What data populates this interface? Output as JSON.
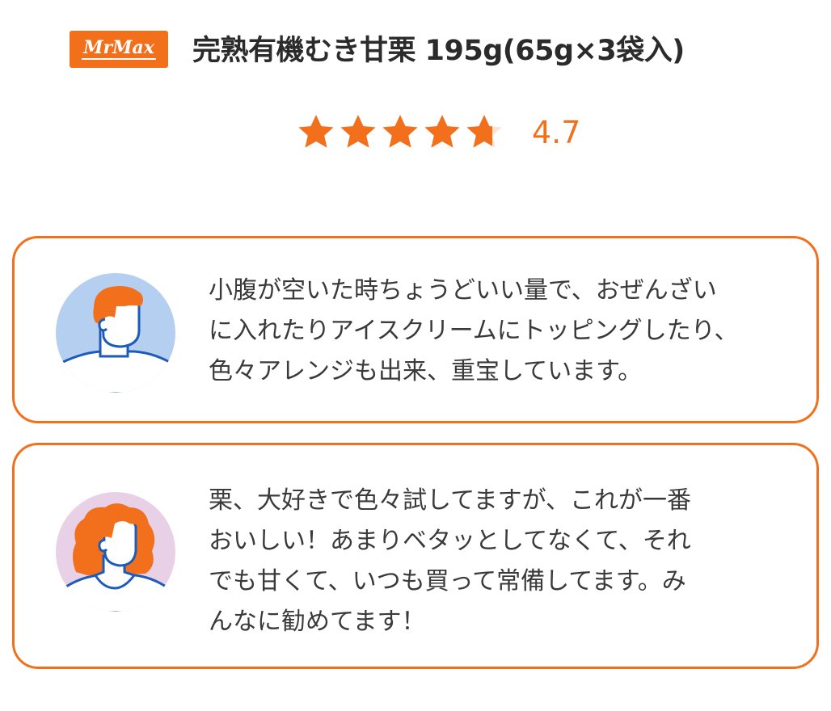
{
  "header": {
    "logo_text": "MrMax",
    "product_title": "完熟有機むき甘栗 195g(65g×3袋入)"
  },
  "rating": {
    "value_text": "4.7",
    "value": 4.7,
    "max": 5
  },
  "colors": {
    "accent": "#f2701c",
    "avatar_1_bg": "#b5cff0",
    "avatar_2_bg": "#e8d0e6",
    "avatar_line": "#1e5bb8"
  },
  "reviews": [
    {
      "avatar": "male-avatar-icon",
      "text": "小腹が空いた時ちょうどいい量で、おぜんざい\nに入れたりアイスクリームにトッピングしたり、\n色々アレンジも出来、重宝しています。"
    },
    {
      "avatar": "female-avatar-icon",
      "text": "栗、大好きで色々試してますが、これが一番\nおいしい！あまりベタッとしてなくて、それ\nでも甘くて、いつも買って常備してます。み\nんなに勧めてます！"
    }
  ]
}
